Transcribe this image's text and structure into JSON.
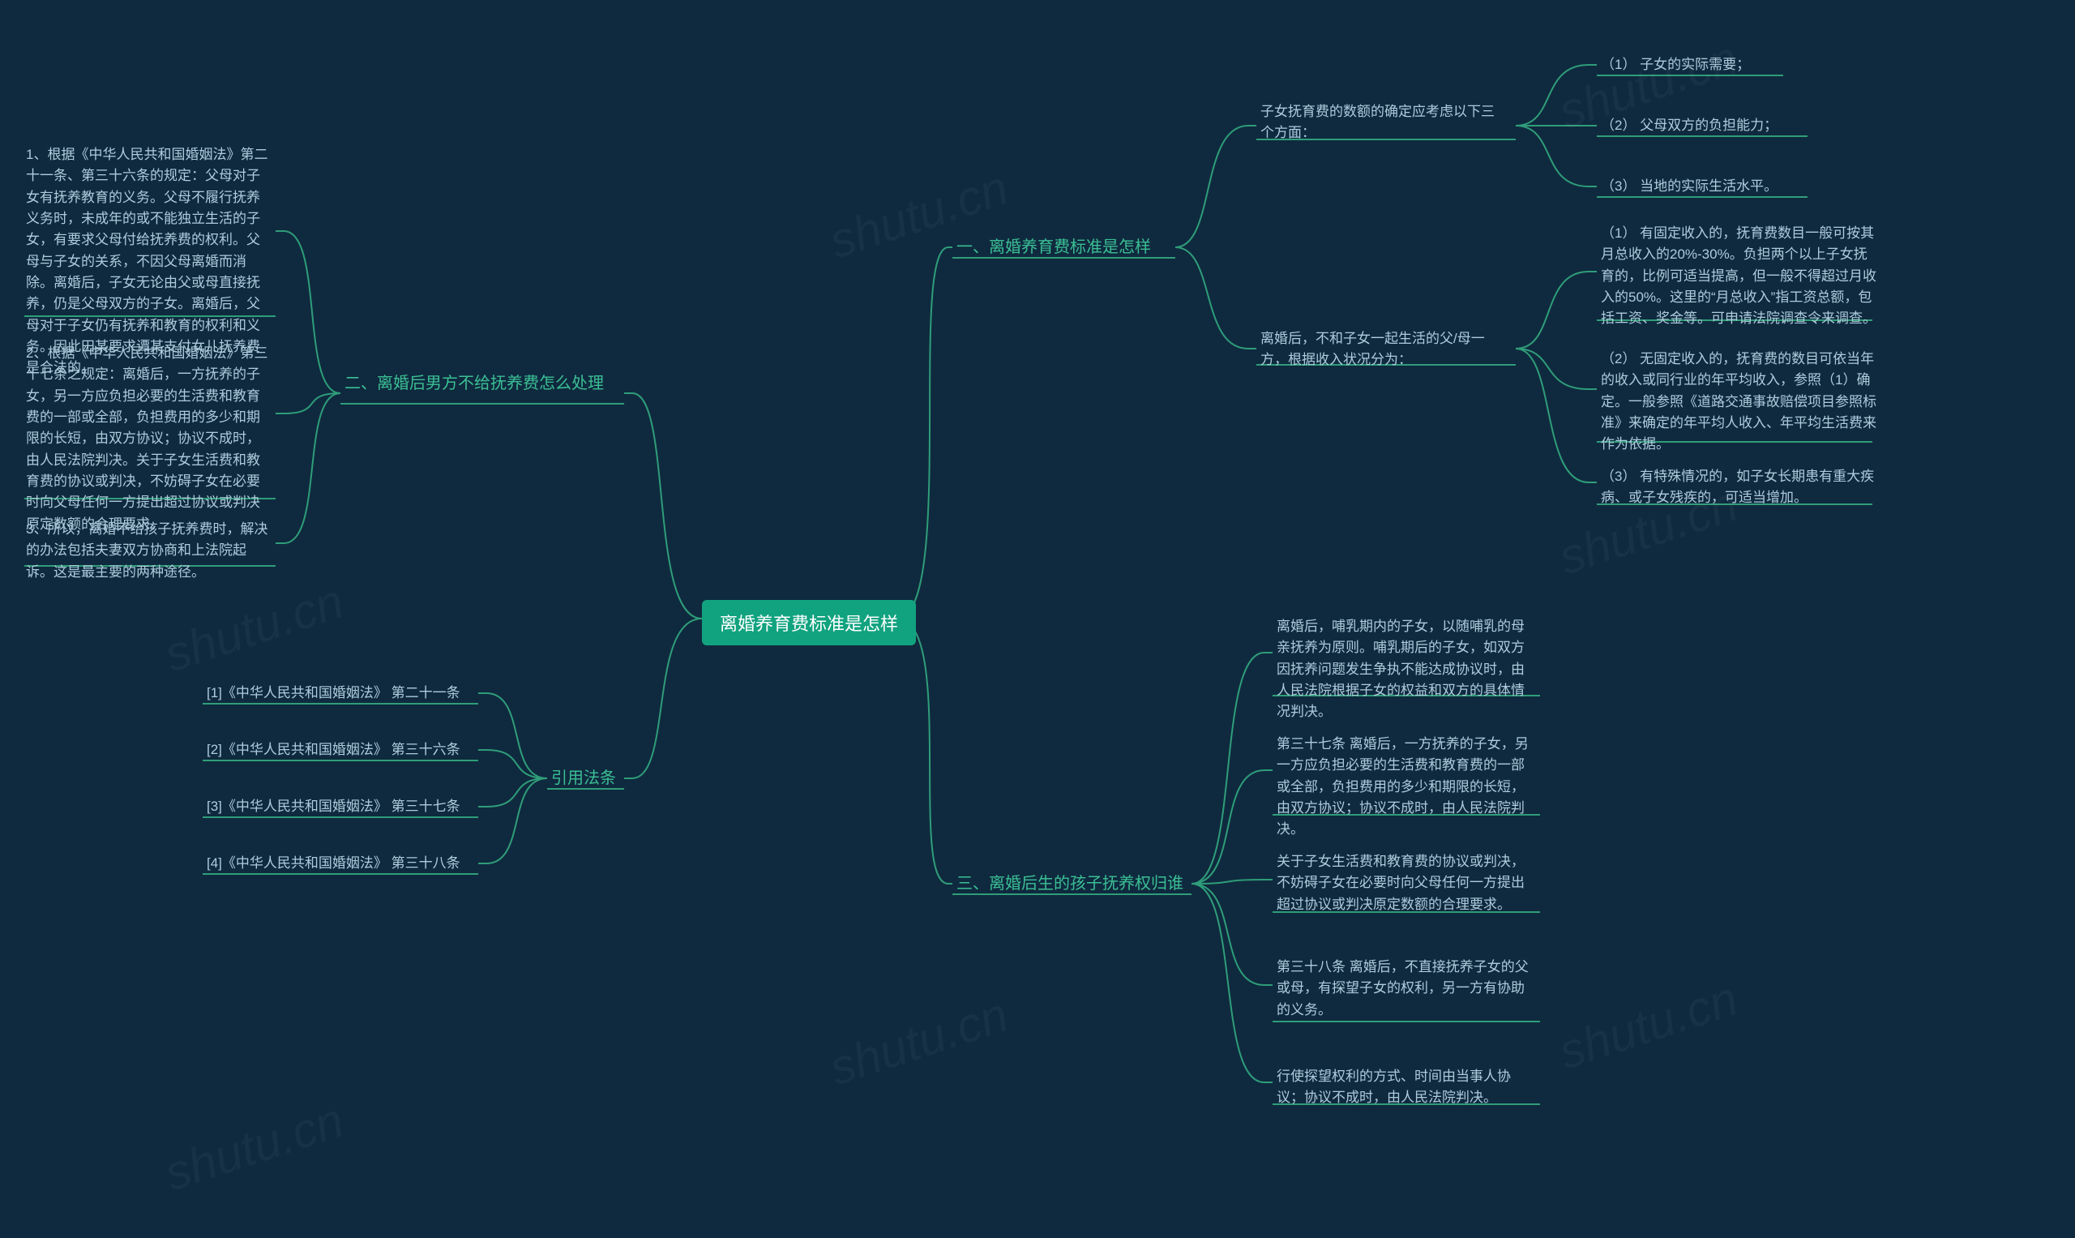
{
  "root": "离婚养育费标准是怎样",
  "right": {
    "b1": {
      "label": "一、离婚养育费标准是怎样",
      "sub1": {
        "label": "子女抚育费的数额的确定应考虑以下三个方面：",
        "n1": "（1） 子女的实际需要；",
        "n2": "（2） 父母双方的负担能力；",
        "n3": "（3） 当地的实际生活水平。"
      },
      "sub2": {
        "label": "离婚后，不和子女一起生活的父/母一方，根据收入状况分为：",
        "n1": "（1） 有固定收入的，抚育费数目一般可按其月总收入的20%-30%。负担两个以上子女抚育的，比例可适当提高，但一般不得超过月收入的50%。这里的“月总收入”指工资总额，包括工资、奖金等。可申请法院调查令来调查。",
        "n2": "（2） 无固定收入的，抚育费的数目可依当年的收入或同行业的年平均收入，参照（1）确定。一般参照《道路交通事故赔偿项目参照标准》来确定的年平均人收入、年平均生活费来作为依据。",
        "n3": "（3） 有特殊情况的，如子女长期患有重大疾病、或子女残疾的，可适当增加。"
      }
    },
    "b3": {
      "label": "三、离婚后生的孩子抚养权归谁",
      "n1": "离婚后，哺乳期内的子女，以随哺乳的母亲抚养为原则。哺乳期后的子女，如双方因抚养问题发生争执不能达成协议时，由人民法院根据子女的权益和双方的具体情况判决。",
      "n2": "第三十七条 离婚后，一方抚养的子女，另一方应负担必要的生活费和教育费的一部或全部，负担费用的多少和期限的长短，由双方协议；协议不成时，由人民法院判决。",
      "n3": "关于子女生活费和教育费的协议或判决，不妨碍子女在必要时向父母任何一方提出超过协议或判决原定数额的合理要求。",
      "n4": "第三十八条 离婚后，不直接抚养子女的父或母，有探望子女的权利，另一方有协助的义务。",
      "n5": "行使探望权利的方式、时间由当事人协议；协议不成时，由人民法院判决。"
    }
  },
  "left": {
    "b2": {
      "label": "二、离婚后男方不给抚养费怎么处理",
      "n1": "1、根据《中华人民共和国婚姻法》第二十一条、第三十六条的规定：父母对子女有抚养教育的义务。父母不履行抚养义务时，未成年的或不能独立生活的子女，有要求父母付给抚养费的权利。父母与子女的关系，不因父母离婚而消除。离婚后，子女无论由父或母直接抚养，仍是父母双方的子女。离婚后，父母对于子女仍有抚养和教育的权利和义务。因此田某要求谭某支付女儿抚养费是合法的。",
      "n2": "2、根据《中华人民共和国婚姻法》第三十七条之规定：离婚后，一方抚养的子女，另一方应负担必要的生活费和教育费的一部或全部，负担费用的多少和期限的长短，由双方协议；协议不成时，由人民法院判决。关于子女生活费和教育费的协议或判决，不妨碍子女在必要时向父母任何一方提出超过协议或判决原定数额的合理要求。",
      "n3": "3、所以，离婚不给孩子抚养费时，解决的办法包括夫妻双方协商和上法院起诉。这是最主要的两种途径。"
    },
    "b4": {
      "label": "引用法条",
      "n1": "[1]《中华人民共和国婚姻法》 第二十一条",
      "n2": "[2]《中华人民共和国婚姻法》 第三十六条",
      "n3": "[3]《中华人民共和国婚姻法》 第三十七条",
      "n4": "[4]《中华人民共和国婚姻法》 第三十八条"
    }
  },
  "watermark": "shutu.cn"
}
